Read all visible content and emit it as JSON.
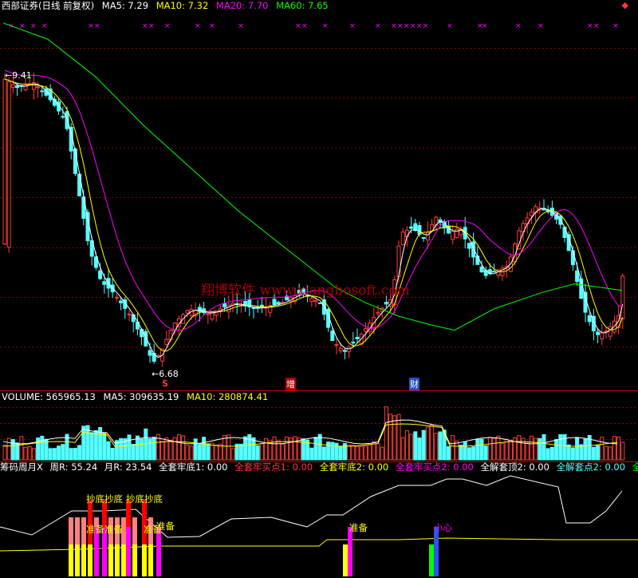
{
  "price_header": {
    "title": "西部证券(日线 前复权)",
    "ma5": "MA5: 7.29",
    "ma10": "MA10: 7.32",
    "ma20": "MA20: 7.70",
    "ma60": "MA60: 7.65"
  },
  "price_markers": {
    "high_label": "9.41",
    "low_label": "6.68",
    "signal_s": "S",
    "signal_zeng": "增",
    "signal_cai": "财"
  },
  "watermark": "翔博软件 www.xiangbosoft.com",
  "volume_header": {
    "volume": "VOLUME: 565965.13",
    "ma5": "MA5: 309635.19",
    "ma10": "MA10: 280874.41"
  },
  "indicator_header": {
    "name": "筹码周月X",
    "week": "周R: 55.24",
    "month": "月R: 23.54",
    "f1": "全套牢底1: 0.00",
    "f2": "全套牢买点1: 0.00",
    "f3": "全套牢底2: 0.00",
    "f4": "全套牢买点2: 0.00",
    "f5": "全解套顶2: 0.00",
    "f6": "全解套点2: 0.00",
    "f7": "全解"
  },
  "indicator_labels": {
    "l1": "抄底抄底",
    "l2": "抄底抄底",
    "l3": "准备准备",
    "l4": "准备",
    "l5": "准备",
    "l6": "准备",
    "l7": "小心"
  },
  "colors": {
    "up": "#ff3b3b",
    "down": "#54ffff",
    "ma5": "#ffffff",
    "ma10": "#ffff00",
    "ma20": "#ff00ff",
    "ma60": "#00ff00",
    "grid": "#8a0000"
  },
  "chart_data": {
    "type": "candlestick",
    "ma_last": {
      "MA5": 7.29,
      "MA10": 7.32,
      "MA20": 7.7,
      "MA60": 7.65
    },
    "price_high": 9.41,
    "price_low": 6.68,
    "volume_last": 565965.13,
    "volume_ma5": 309635.19,
    "volume_ma10": 280874.41,
    "week_R": 55.24,
    "month_R": 23.54
  }
}
